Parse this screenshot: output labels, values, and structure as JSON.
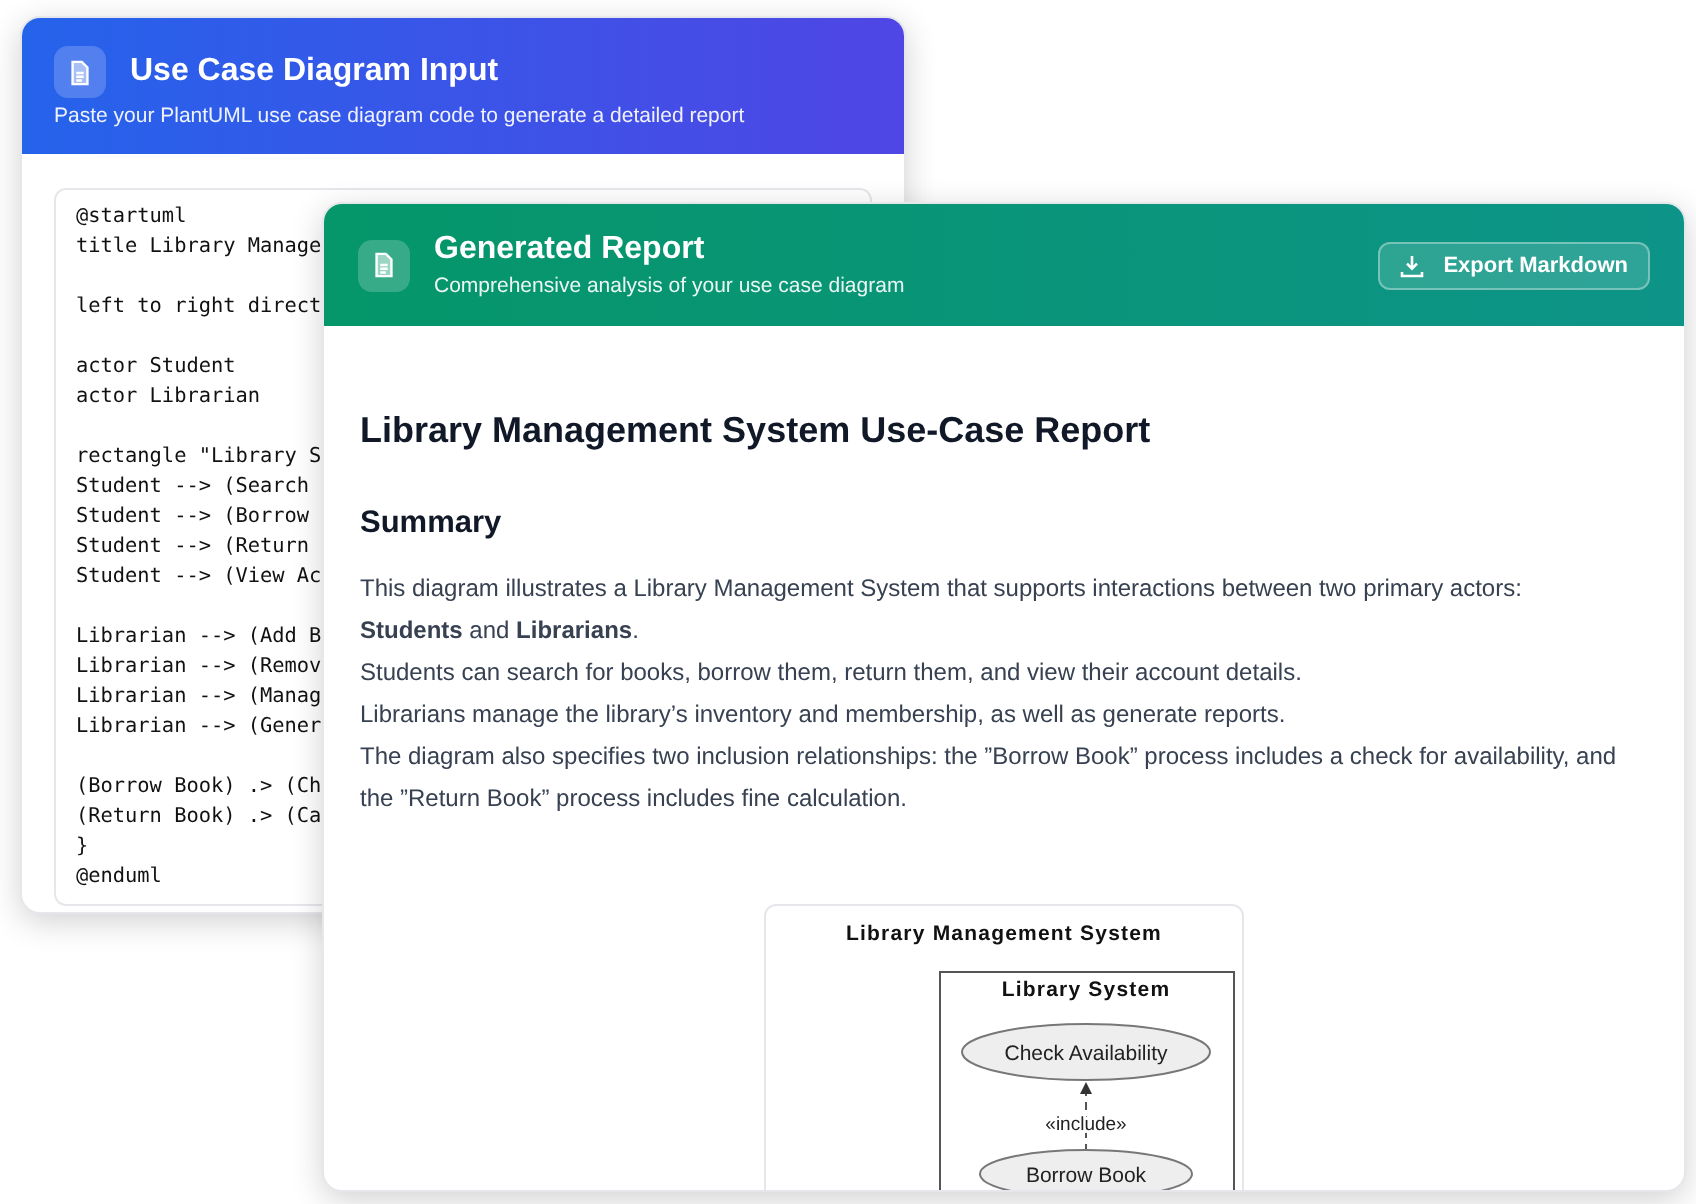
{
  "input_window": {
    "title": "Use Case Diagram Input",
    "subtitle": "Paste your PlantUML use case diagram code to generate a detailed report",
    "code_blocks": [
      [
        "@startuml",
        "title Library Manage"
      ],
      [
        "left to right direct"
      ],
      [
        "actor Student",
        "actor Librarian"
      ],
      [
        "rectangle \"Library S",
        "Student --> (Search",
        "Student --> (Borrow",
        "Student --> (Return",
        "Student --> (View Ac"
      ],
      [
        "Librarian --> (Add B",
        "Librarian --> (Remov",
        "Librarian --> (Manag",
        "Librarian --> (Gener"
      ],
      [
        "(Borrow Book) .> (Ch",
        "(Return Book) .> (Ca",
        "}",
        "@enduml"
      ]
    ]
  },
  "report_window": {
    "title": "Generated Report",
    "subtitle": "Comprehensive analysis of your use case diagram",
    "export_button": "Export Markdown",
    "heading": "Library Management System Use-Case Report",
    "section": "Summary",
    "lines": [
      "This diagram illustrates a Library Management System that supports interactions between two primary actors:",
      "**Students** and **Librarians**.",
      "Students can search for books, borrow them, return them, and view their account details.",
      "Librarians manage the library’s inventory and membership, as well as generate reports.",
      "The diagram also specifies two inclusion relationships: the ”Borrow Book” process includes a check for availability, and the ”Return Book” process includes fine calculation."
    ],
    "diagram": {
      "title": "Library Management System",
      "boundary": "Library System",
      "use_cases": [
        "Check Availability",
        "Borrow Book"
      ],
      "relation": "«include»"
    }
  }
}
